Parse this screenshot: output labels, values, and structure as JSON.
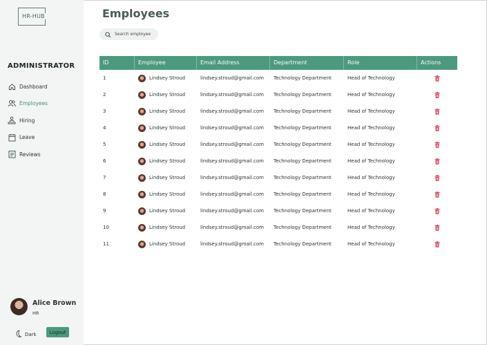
{
  "app": {
    "logo_text": "HR-HUB"
  },
  "sidebar": {
    "role_title": "ADMINISTRATOR",
    "items": [
      {
        "label": "Dashboard",
        "icon": "home-icon",
        "active": false
      },
      {
        "label": "Employees",
        "icon": "users-icon",
        "active": true
      },
      {
        "label": "Hiring",
        "icon": "hiring-icon",
        "active": false
      },
      {
        "label": "Leave",
        "icon": "calendar-icon",
        "active": false
      },
      {
        "label": "Reviews",
        "icon": "reviews-icon",
        "active": false
      }
    ],
    "user": {
      "name": "Alice Brown",
      "role": "HR"
    },
    "dark_label": "Dark",
    "logout_label": "Logout"
  },
  "main": {
    "title": "Employees",
    "search": {
      "placeholder": "Search employee",
      "value": ""
    }
  },
  "table": {
    "headers": [
      "ID",
      "Employee",
      "Email Address",
      "Department",
      "Role",
      "Actions"
    ],
    "rows": [
      {
        "id": "1",
        "employee": "Lindsey Stroud",
        "email": "lindsey.stroud@gmail.com",
        "department": "Technology Department",
        "role": "Head of Technology"
      },
      {
        "id": "2",
        "employee": "Lindsey Stroud",
        "email": "lindsey.stroud@gmail.com",
        "department": "Technology Department",
        "role": "Head of Technology"
      },
      {
        "id": "3",
        "employee": "Lindsey Stroud",
        "email": "lindsey.stroud@gmail.com",
        "department": "Technology Department",
        "role": "Head of Technology"
      },
      {
        "id": "4",
        "employee": "Lindsey Stroud",
        "email": "lindsey.stroud@gmail.com",
        "department": "Technology Department",
        "role": "Head of Technology"
      },
      {
        "id": "5",
        "employee": "Lindsey Stroud",
        "email": "lindsey.stroud@gmail.com",
        "department": "Technology Department",
        "role": "Head of Technology"
      },
      {
        "id": "6",
        "employee": "Lindsey Stroud",
        "email": "lindsey.stroud@gmail.com",
        "department": "Technology Department",
        "role": "Head of Technology"
      },
      {
        "id": "7",
        "employee": "Lindsey Stroud",
        "email": "lindsey.stroud@gmail.com",
        "department": "Technology Department",
        "role": "Head of Technology"
      },
      {
        "id": "8",
        "employee": "Lindsey Stroud",
        "email": "lindsey.stroud@gmail.com",
        "department": "Technology Department",
        "role": "Head of Technology"
      },
      {
        "id": "9",
        "employee": "Lindsey Stroud",
        "email": "lindsey.stroud@gmail.com",
        "department": "Technology Department",
        "role": "Head of Technology"
      },
      {
        "id": "10",
        "employee": "Lindsey Stroud",
        "email": "lindsey.stroud@gmail.com",
        "department": "Technology Department",
        "role": "Head of Technology"
      },
      {
        "id": "11",
        "employee": "Lindsey Stroud",
        "email": "lindsey.stroud@gmail.com",
        "department": "Technology Department",
        "role": "Head of Technology"
      }
    ]
  },
  "colors": {
    "accent": "#4c9a7e",
    "active_nav": "#3f8f74",
    "delete": "#e2455e",
    "sidebar_bg": "#f3f5f4"
  }
}
